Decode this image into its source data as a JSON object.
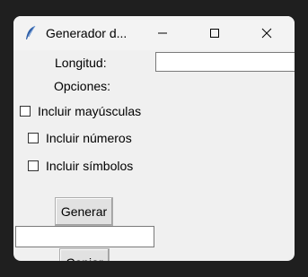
{
  "window": {
    "title": "Generador d...",
    "controls": {
      "minimize_icon": "minimize-icon",
      "maximize_icon": "maximize-icon",
      "close_icon": "close-icon"
    }
  },
  "form": {
    "length_label": "Longitud:",
    "length_value": "",
    "options_label": "Opciones:",
    "options": [
      {
        "label": "Incluir mayúsculas",
        "checked": false
      },
      {
        "label": "Incluir números",
        "checked": false
      },
      {
        "label": "Incluir símbolos",
        "checked": false
      }
    ],
    "generate_label": "Generar",
    "output_value": "",
    "copy_label": "Copiar"
  }
}
